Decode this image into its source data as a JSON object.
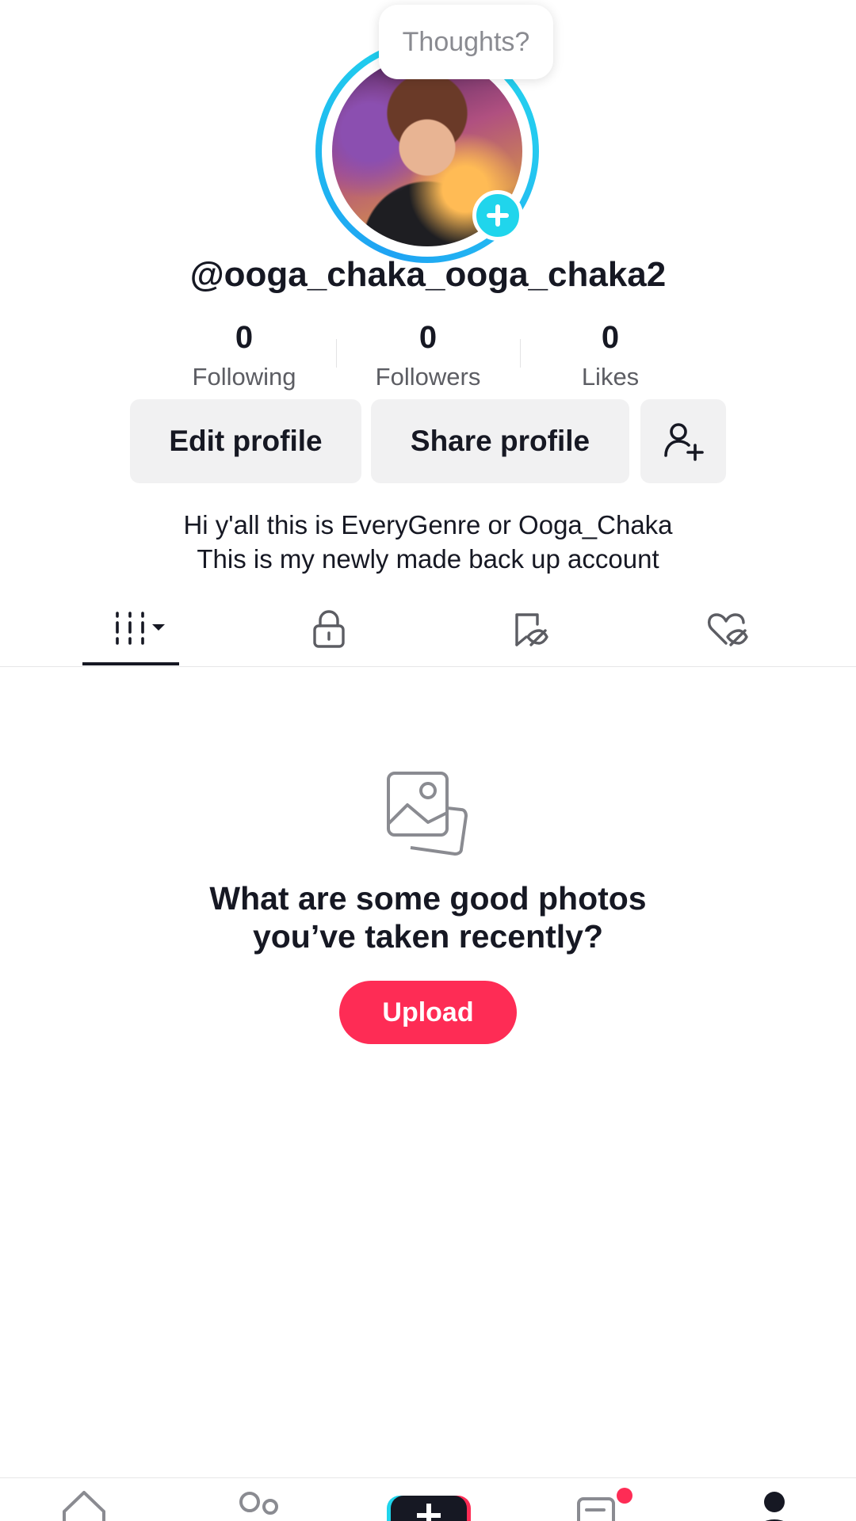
{
  "profile": {
    "thoughts_prompt": "Thoughts?",
    "username": "@ooga_chaka_ooga_chaka2",
    "stats": [
      {
        "value": "0",
        "label": "Following"
      },
      {
        "value": "0",
        "label": "Followers"
      },
      {
        "value": "0",
        "label": "Likes"
      }
    ],
    "edit_button": "Edit profile",
    "share_button": "Share profile",
    "bio_lines": [
      "Hi y'all this is EveryGenre or Ooga_Chaka",
      "This is my newly made back up account"
    ]
  },
  "tabs": [
    {
      "icon": "grid-videos-icon",
      "selected": true
    },
    {
      "icon": "lock-icon",
      "selected": false
    },
    {
      "icon": "bookmark-hidden-icon",
      "selected": false
    },
    {
      "icon": "heart-hidden-icon",
      "selected": false
    }
  ],
  "empty_state": {
    "icon": "photos-icon",
    "title_line1": "What are some good photos",
    "title_line2": "you’ve taken recently?",
    "upload_button": "Upload"
  },
  "bottom_nav": [
    {
      "icon": "home-icon"
    },
    {
      "icon": "friends-icon"
    },
    {
      "icon": "create-icon"
    },
    {
      "icon": "inbox-icon",
      "badge": true
    },
    {
      "icon": "profile-icon"
    }
  ],
  "colors": {
    "accent_cyan": "#20d5ec",
    "accent_red": "#fe2c55",
    "button_grey": "#f1f1f2",
    "text_primary": "#161823"
  }
}
